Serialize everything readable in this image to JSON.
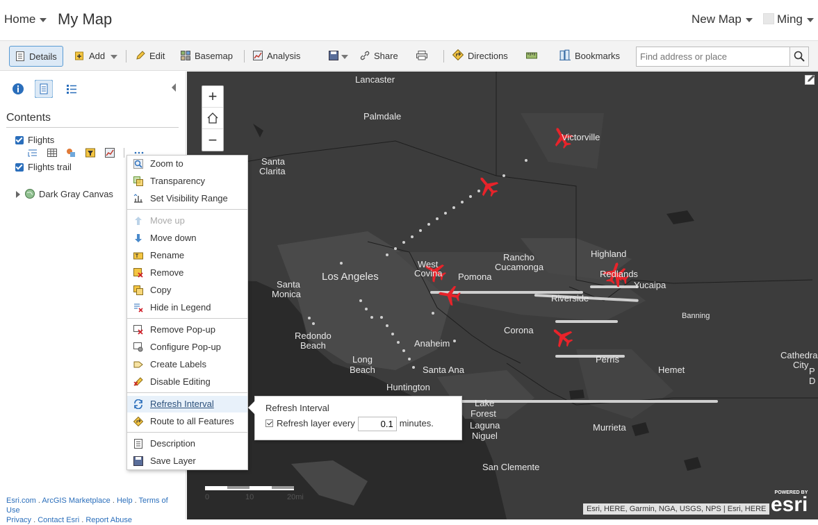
{
  "header": {
    "home_label": "Home",
    "map_title": "My Map",
    "new_map_label": "New Map",
    "user_name": "Ming"
  },
  "toolbar": {
    "details": "Details",
    "add": "Add",
    "edit": "Edit",
    "basemap": "Basemap",
    "analysis": "Analysis",
    "share": "Share",
    "directions": "Directions",
    "bookmarks": "Bookmarks",
    "search_placeholder": "Find address or place"
  },
  "panel": {
    "contents_heading": "Contents",
    "layers": [
      {
        "label": "Flights",
        "checked": true
      },
      {
        "label": "Flights trail",
        "checked": true
      },
      {
        "label": "Dark Gray Canvas"
      }
    ]
  },
  "context_menu": {
    "items": [
      {
        "label": "Zoom to",
        "icon": "zoom-to-icon"
      },
      {
        "label": "Transparency",
        "icon": "transparency-icon"
      },
      {
        "label": "Set Visibility Range",
        "icon": "visibility-range-icon"
      },
      {
        "label": "Move up",
        "icon": "arrow-up-icon",
        "disabled": true
      },
      {
        "label": "Move down",
        "icon": "arrow-down-icon"
      },
      {
        "label": "Rename",
        "icon": "rename-icon"
      },
      {
        "label": "Remove",
        "icon": "remove-icon"
      },
      {
        "label": "Copy",
        "icon": "copy-icon"
      },
      {
        "label": "Hide in Legend",
        "icon": "hide-legend-icon"
      },
      {
        "label": "Remove Pop-up",
        "icon": "remove-popup-icon"
      },
      {
        "label": "Configure Pop-up",
        "icon": "configure-popup-icon"
      },
      {
        "label": "Create Labels",
        "icon": "labels-icon"
      },
      {
        "label": "Disable Editing",
        "icon": "disable-editing-icon"
      },
      {
        "label": "Refresh Interval",
        "icon": "refresh-icon",
        "highlighted": true
      },
      {
        "label": "Route to all Features",
        "icon": "route-icon"
      },
      {
        "label": "Description",
        "icon": "description-icon"
      },
      {
        "label": "Save Layer",
        "icon": "save-icon"
      }
    ]
  },
  "refresh_popup": {
    "title": "Refresh Interval",
    "checkbox_label": "Refresh layer every",
    "value": "0.1",
    "unit": "minutes."
  },
  "map": {
    "cities": [
      "Lancaster",
      "Palmdale",
      "Victorville",
      "Santa",
      "Clarita",
      "Los Angeles",
      "West",
      "Covina",
      "Pomona",
      "Rancho",
      "Cucamonga",
      "Highland",
      "Redlands",
      "Yucaipa",
      "Riverside",
      "Banning",
      "Santa",
      "Monica",
      "Redondo",
      "Beach",
      "Long",
      "Beach",
      "Anaheim",
      "Santa Ana",
      "Corona",
      "Perris",
      "Hemet",
      "Huntington",
      "Lake",
      "Forest",
      "Laguna",
      "Niguel",
      "Murrieta",
      "San Clemente",
      "Cathedra",
      "City",
      "P",
      "D"
    ],
    "attribution": "Esri, HERE, Garmin, NGA, USGS, NPS | Esri, HERE",
    "powered_by": "POWERED BY",
    "logo_text": "esri",
    "scale_labels": [
      "0",
      "10",
      "20mi"
    ]
  },
  "footer": {
    "links": [
      "Esri.com",
      "ArcGIS Marketplace",
      "Help",
      "Terms of Use",
      "Privacy",
      "Contact Esri",
      "Report Abuse"
    ]
  },
  "colors": {
    "accent": "#2a6ebb",
    "map_bg": "#3c3c3c",
    "plane": "#e8232a"
  }
}
